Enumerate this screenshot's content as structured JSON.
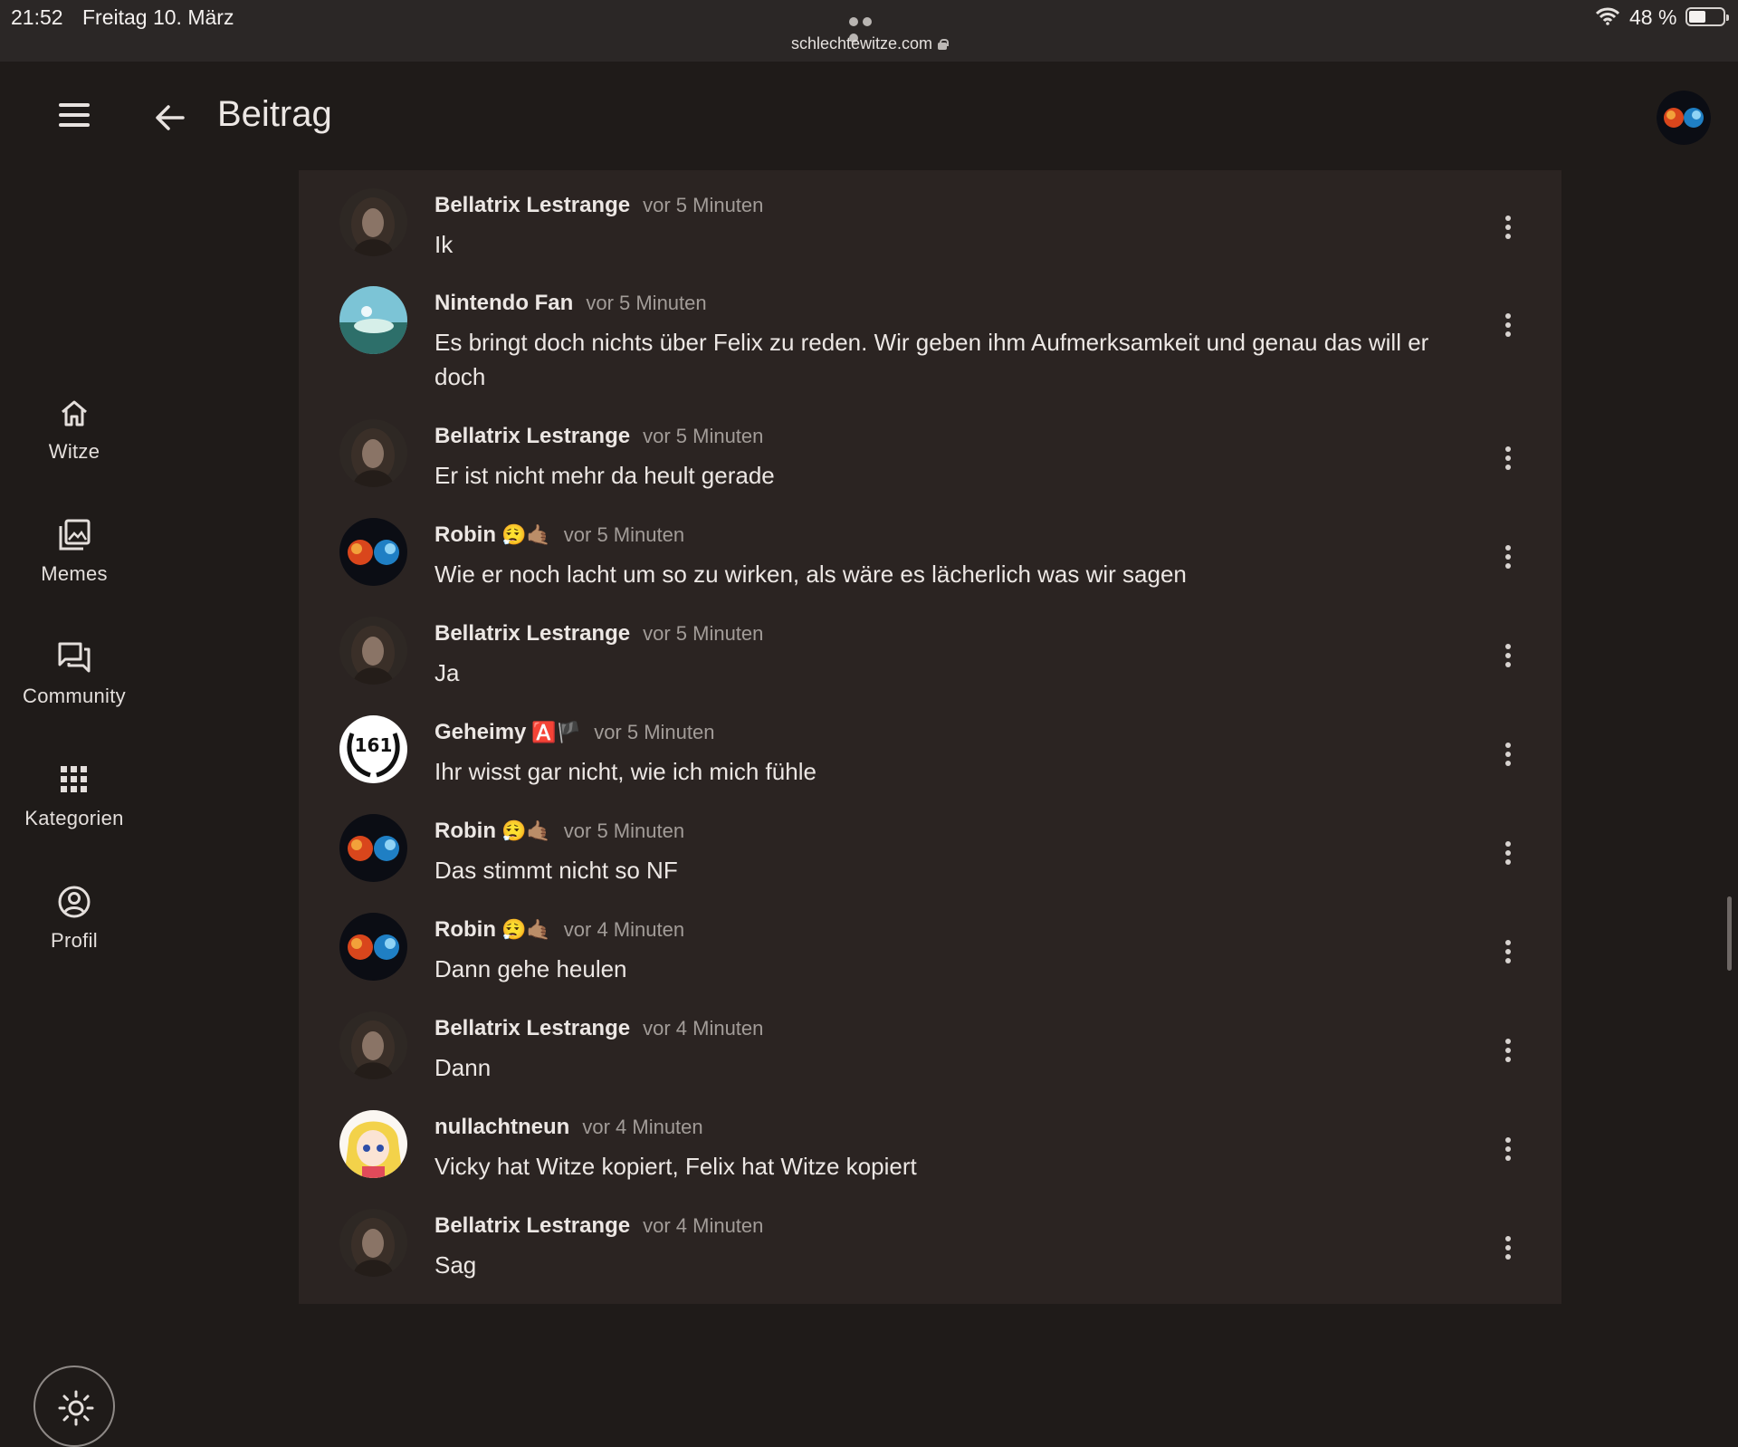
{
  "status": {
    "time": "21:52",
    "date": "Freitag 10. März",
    "url": "schlechtewitze.com",
    "battery": "48 %"
  },
  "app_bar": {
    "title": "Beitrag"
  },
  "rail": [
    {
      "label": "Witze",
      "icon": "home-icon"
    },
    {
      "label": "Memes",
      "icon": "images-icon"
    },
    {
      "label": "Community",
      "icon": "forum-icon"
    },
    {
      "label": "Kategorien",
      "icon": "apps-grid-icon"
    },
    {
      "label": "Profil",
      "icon": "account-circle-icon"
    }
  ],
  "comments": [
    {
      "author": "Bellatrix Lestrange",
      "badges": "",
      "time": "vor 5 Minuten",
      "text": "Ik"
    },
    {
      "author": "Nintendo Fan",
      "badges": "",
      "time": "vor 5 Minuten",
      "text": "Es bringt doch nichts über Felix zu reden. Wir geben ihm Aufmerksamkeit und genau das will er doch"
    },
    {
      "author": "Bellatrix Lestrange",
      "badges": "",
      "time": "vor 5 Minuten",
      "text": "Er ist nicht mehr da heult gerade"
    },
    {
      "author": "Robin",
      "badges": "😮‍💨🤙🏽",
      "time": "vor 5 Minuten",
      "text": "Wie er noch lacht um so zu wirken, als wäre es lächerlich was wir sagen"
    },
    {
      "author": "Bellatrix Lestrange",
      "badges": "",
      "time": "vor 5 Minuten",
      "text": "Ja"
    },
    {
      "author": "Geheimy",
      "badges": "🅰️🏴",
      "time": "vor 5 Minuten",
      "text": "Ihr wisst gar nicht, wie ich mich fühle"
    },
    {
      "author": "Robin",
      "badges": "😮‍💨🤙🏽",
      "time": "vor 5 Minuten",
      "text": "Das stimmt nicht so NF"
    },
    {
      "author": "Robin",
      "badges": "😮‍💨🤙🏽",
      "time": "vor 4 Minuten",
      "text": "Dann gehe heulen"
    },
    {
      "author": "Bellatrix Lestrange",
      "badges": "",
      "time": "vor 4 Minuten",
      "text": "Dann"
    },
    {
      "author": "nullachtneun",
      "badges": "",
      "time": "vor 4 Minuten",
      "text": "Vicky hat Witze kopiert, Felix hat Witze kopiert"
    },
    {
      "author": "Bellatrix Lestrange",
      "badges": "",
      "time": "vor 4 Minuten",
      "text": "Sag"
    }
  ],
  "avatar_logo_text": "161",
  "colors": {
    "background": "#1f1b19",
    "panel": "#2b2422",
    "status_bar": "#2b2726",
    "text": "#ece7e4",
    "muted": "#a29c98"
  }
}
